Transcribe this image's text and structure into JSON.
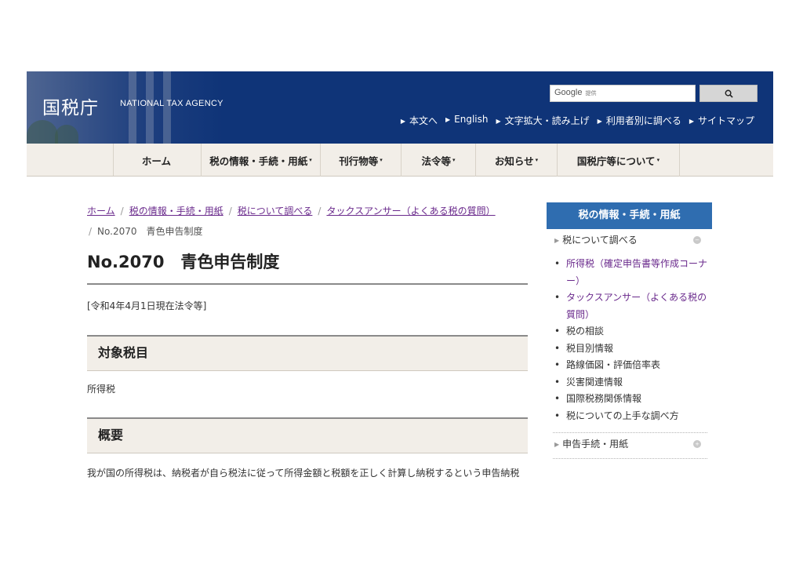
{
  "header": {
    "logo": "国税庁",
    "logo_sub": "NATIONAL TAX AGENCY",
    "search_brand": "Google",
    "search_provided": "提供",
    "search_button_icon": "search-icon",
    "utility_links": [
      "本文へ",
      "English",
      "文字拡大・読み上げ",
      "利用者別に調べる",
      "サイトマップ"
    ]
  },
  "gnav": [
    {
      "label": "ホーム",
      "caret": ""
    },
    {
      "label": "税の情報・手続・用紙",
      "caret": "▾"
    },
    {
      "label": "刊行物等",
      "caret": "▾"
    },
    {
      "label": "法令等",
      "caret": "▾"
    },
    {
      "label": "お知らせ",
      "caret": "▾"
    },
    {
      "label": "国税庁等について",
      "caret": "▾"
    }
  ],
  "breadcrumb": {
    "items": [
      "ホーム",
      "税の情報・手続・用紙",
      "税について調べる",
      "タックスアンサー（よくある税の質問）"
    ],
    "current": "No.2070　青色申告制度"
  },
  "main": {
    "title": "No.2070　青色申告制度",
    "date_note": "[令和4年4月1日現在法令等]",
    "sections": [
      {
        "heading": "対象税目",
        "body": "所得税"
      },
      {
        "heading": "概要",
        "body": "我が国の所得税は、納税者が自ら税法に従って所得金額と税額を正しく計算し納税するという申告納税"
      }
    ]
  },
  "sidebar": {
    "heading": "税の情報・手続・用紙",
    "sub1": "税について調べる",
    "links": [
      "所得税（確定申告書等作成コーナー）",
      "タックスアンサー（よくある税の質問）",
      "税の相談",
      "税目別情報",
      "路線価図・評価倍率表",
      "災害関連情報",
      "国際税務関係情報",
      "税についての上手な調べ方"
    ],
    "sub2": "申告手続・用紙",
    "expand_icon": "plus-circle-icon"
  },
  "colors": {
    "header_bg": "#0f3478",
    "nav_bg": "#f2eee8",
    "sidebar_head": "#2f6db0",
    "link_purple": "#6a2a8c"
  }
}
